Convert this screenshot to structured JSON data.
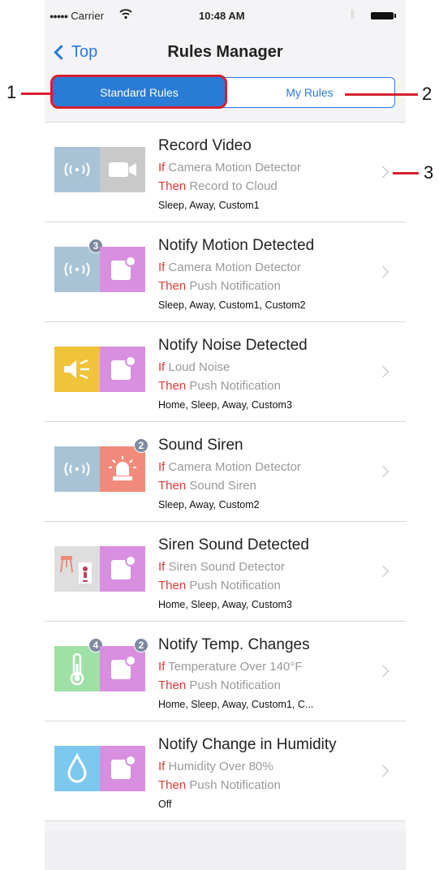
{
  "status_bar": {
    "carrier": "Carrier",
    "time": "10:48 AM"
  },
  "nav": {
    "back_label": "Top",
    "title": "Rules Manager"
  },
  "segments": {
    "standard": "Standard Rules",
    "mine": "My Rules",
    "selected": "standard"
  },
  "rules": [
    {
      "title": "Record Video",
      "if_kw": "If",
      "if_text": "Camera Motion Detector",
      "then_kw": "Then",
      "then_text": "Record to Cloud",
      "modes": "Sleep, Away, Custom1",
      "left_icon": "motion-sensor-icon",
      "right_icon": "video-camera-icon"
    },
    {
      "title": "Notify Motion Detected",
      "if_kw": "If",
      "if_text": "Camera Motion Detector",
      "then_kw": "Then",
      "then_text": "Push Notification",
      "modes": "Sleep, Away, Custom1, Custom2",
      "left_icon": "motion-sensor-icon",
      "right_icon": "push-notification-icon",
      "left_badge": "3"
    },
    {
      "title": "Notify Noise Detected",
      "if_kw": "If",
      "if_text": "Loud Noise",
      "then_kw": "Then",
      "then_text": "Push Notification",
      "modes": "Home, Sleep, Away, Custom3",
      "left_icon": "loud-noise-icon",
      "right_icon": "push-notification-icon"
    },
    {
      "title": "Sound Siren",
      "if_kw": "If",
      "if_text": "Camera Motion Detector",
      "then_kw": "Then",
      "then_text": "Sound Siren",
      "modes": "Sleep, Away, Custom2",
      "left_icon": "motion-sensor-icon",
      "right_icon": "siren-icon",
      "right_badge": "2"
    },
    {
      "title": "Siren Sound Detected",
      "if_kw": "If",
      "if_text": "Siren Sound Detector",
      "then_kw": "Then",
      "then_text": "Push Notification",
      "modes": "Home, Sleep, Away, Custom3",
      "left_icon": "siren-detector-icon",
      "right_icon": "push-notification-icon"
    },
    {
      "title": "Notify Temp. Changes",
      "if_kw": "If",
      "if_text": "Temperature Over 140°F",
      "then_kw": "Then",
      "then_text": "Push Notification",
      "modes": "Home, Sleep, Away, Custom1, C...",
      "left_icon": "thermometer-icon",
      "right_icon": "push-notification-icon",
      "left_badge": "4",
      "right_badge": "2"
    },
    {
      "title": "Notify Change in Humidity",
      "if_kw": "If",
      "if_text": "Humidity Over 80%",
      "then_kw": "Then",
      "then_text": "Push Notification",
      "modes": "Off",
      "left_icon": "humidity-drop-icon",
      "right_icon": "push-notification-icon"
    }
  ],
  "annotations": {
    "one": "1",
    "two": "2",
    "three": "3"
  },
  "colors": {
    "accent": "#2a7bd6",
    "keyword_red": "#e03a32",
    "annotation_red": "#d6202f",
    "motion_tile": "#a9c3d6",
    "camera_tile": "#c9c9c9",
    "notification_tile": "#d98fe0",
    "noise_tile": "#f0c33a",
    "siren_tile": "#f08a7a",
    "siren_detector_tile": "#dedede",
    "thermometer_tile": "#9fe0a6",
    "humidity_tile": "#7cc8ee"
  }
}
